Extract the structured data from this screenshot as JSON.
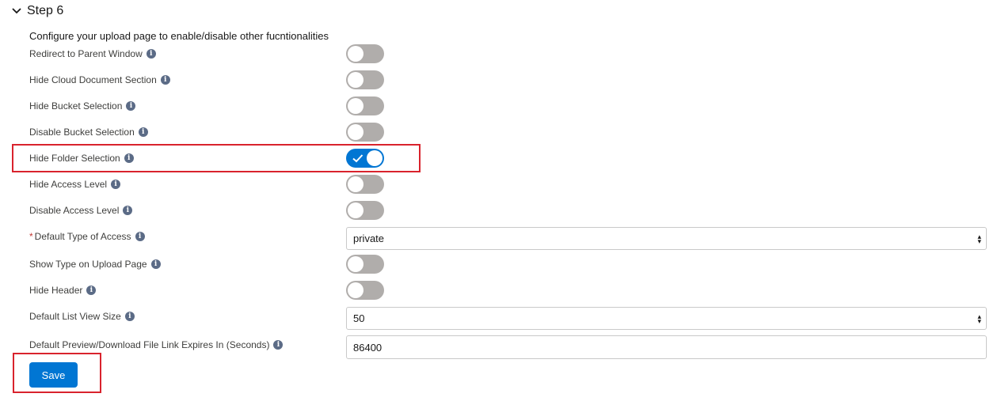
{
  "step": {
    "title": "Step 6"
  },
  "intro": "Configure your upload page to enable/disable other fucntionalities",
  "settings": {
    "redirect_parent": {
      "label": "Redirect to Parent Window",
      "enabled": false
    },
    "hide_cloud_doc": {
      "label": "Hide Cloud Document Section",
      "enabled": false
    },
    "hide_bucket": {
      "label": "Hide Bucket Selection",
      "enabled": false
    },
    "disable_bucket": {
      "label": "Disable Bucket Selection",
      "enabled": false
    },
    "hide_folder": {
      "label": "Hide Folder Selection",
      "enabled": true
    },
    "hide_access": {
      "label": "Hide Access Level",
      "enabled": false
    },
    "disable_access": {
      "label": "Disable Access Level",
      "enabled": false
    },
    "default_access": {
      "label": "Default Type of Access",
      "required_marker": "*",
      "value": "private"
    },
    "show_type": {
      "label": "Show Type on Upload Page",
      "enabled": false
    },
    "hide_header": {
      "label": "Hide Header",
      "enabled": false
    },
    "list_view_size": {
      "label": "Default List View Size",
      "value": "50"
    },
    "link_expiry": {
      "label": "Default Preview/Download File Link Expires In (Seconds)",
      "value": "86400"
    }
  },
  "save_label": "Save",
  "icons": {
    "info": "info-icon",
    "chevron": "chevron-down-icon",
    "check": "check-icon",
    "dropdown": "dropdown-arrow-icon"
  },
  "colors": {
    "accent": "#0176d3",
    "toggle_off": "#b0adab",
    "highlight": "#d9232d"
  }
}
